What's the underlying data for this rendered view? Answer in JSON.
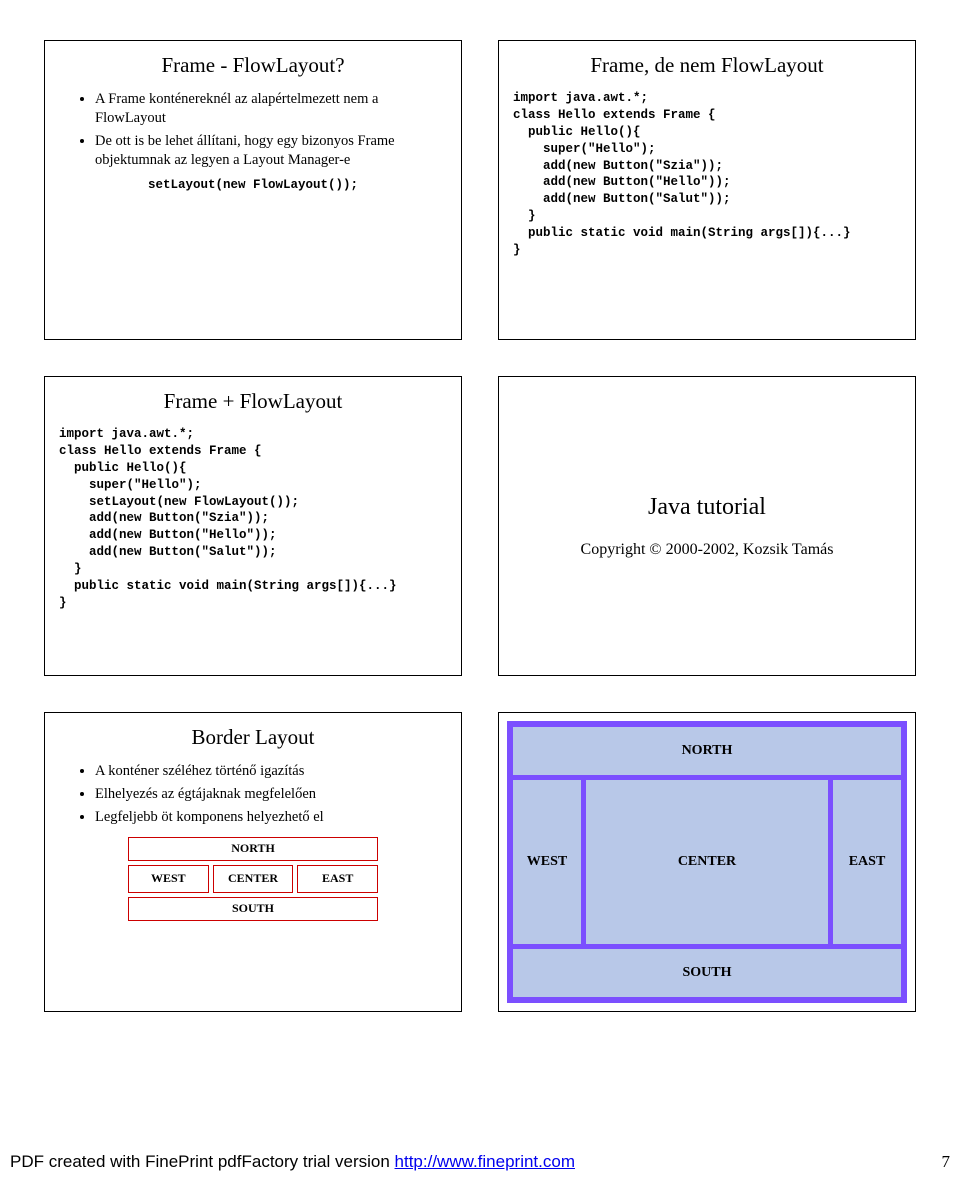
{
  "slides": {
    "s1": {
      "title": "Frame - FlowLayout?",
      "bullets": [
        "A Frame konténereknél az alapértelmezett nem a FlowLayout",
        "De ott is be lehet állítani, hogy egy bizonyos Frame objektumnak az legyen a Layout Manager-e"
      ],
      "code": "setLayout(new FlowLayout());"
    },
    "s2": {
      "title": "Frame, de nem FlowLayout",
      "code": "import java.awt.*;\nclass Hello extends Frame {\n  public Hello(){\n    super(\"Hello\");\n    add(new Button(\"Szia\"));\n    add(new Button(\"Hello\"));\n    add(new Button(\"Salut\"));\n  }\n  public static void main(String args[]){...}\n}"
    },
    "s3": {
      "title": "Frame + FlowLayout",
      "code": "import java.awt.*;\nclass Hello extends Frame {\n  public Hello(){\n    super(\"Hello\");\n    setLayout(new FlowLayout());\n    add(new Button(\"Szia\"));\n    add(new Button(\"Hello\"));\n    add(new Button(\"Salut\"));\n  }\n  public static void main(String args[]){...}\n}"
    },
    "s4": {
      "title": "Java tutorial",
      "copy": "Copyright © 2000-2002, Kozsik Tamás"
    },
    "s5": {
      "title": "Border Layout",
      "bullets": [
        "A konténer széléhez történő igazítás",
        "Elhelyezés az égtájaknak megfelelően",
        "Legfeljebb öt komponens helyezhető el"
      ],
      "labels": {
        "n": "NORTH",
        "s": "SOUTH",
        "w": "WEST",
        "e": "EAST",
        "c": "CENTER"
      }
    },
    "s6": {
      "labels": {
        "n": "NORTH",
        "s": "SOUTH",
        "w": "WEST",
        "e": "EAST",
        "c": "CENTER"
      }
    }
  },
  "footer": {
    "text_prefix": "PDF created with FinePrint pdfFactory trial version ",
    "link_text": "http://www.fineprint.com",
    "page": "7"
  }
}
